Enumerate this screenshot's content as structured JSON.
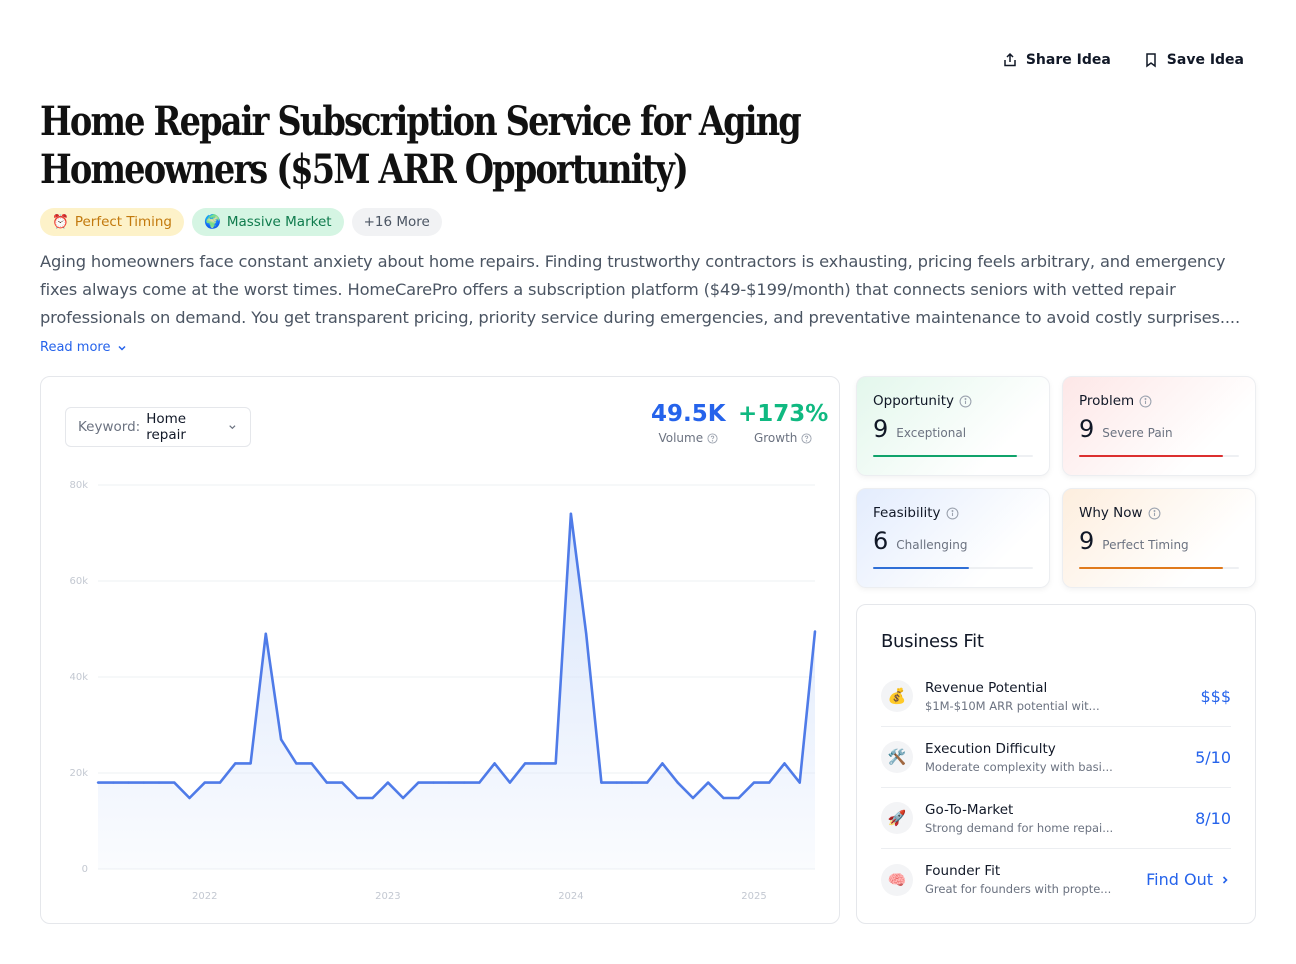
{
  "header": {
    "share_label": "Share Idea",
    "save_label": "Save Idea",
    "title": "Home Repair Subscription Service for Aging Homeowners ($5M ARR Opportunity)"
  },
  "tags": [
    {
      "emoji": "⏰",
      "label": "Perfect Timing"
    },
    {
      "emoji": "🌍",
      "label": "Massive Market"
    },
    {
      "label": "+16 More"
    }
  ],
  "description": "Aging homeowners face constant anxiety about home repairs. Finding trustworthy contractors is exhausting, pricing feels arbitrary, and emergency fixes always come at the worst times. HomeCarePro offers a subscription platform ($49-$199/month) that connects seniors with vetted repair professionals on demand. You get transparent pricing, priority service during emergencies, and preventative maintenance to avoid costly surprises....",
  "read_more": "Read more",
  "keyword": {
    "label": "Keyword:",
    "value": "Home repair"
  },
  "metrics": {
    "volume": {
      "value": "49.5K",
      "label": "Volume"
    },
    "growth": {
      "value": "+173%",
      "label": "Growth"
    }
  },
  "chart_data": {
    "type": "area",
    "y_ticks": [
      "0",
      "20k",
      "40k",
      "60k",
      "80k"
    ],
    "ylim": [
      0,
      80000
    ],
    "x_ticks": [
      {
        "label": "2022",
        "month": 7
      },
      {
        "label": "2023",
        "month": 19
      },
      {
        "label": "2024",
        "month": 31
      },
      {
        "label": "2025",
        "month": 43
      }
    ],
    "x_range": [
      0,
      47
    ],
    "series": [
      {
        "values": [
          18000,
          18000,
          18000,
          18000,
          18000,
          18000,
          14800,
          18000,
          18000,
          22000,
          22000,
          49000,
          27000,
          22000,
          22000,
          18000,
          18000,
          14800,
          14800,
          18000,
          14800,
          18000,
          18000,
          18000,
          18000,
          18000,
          22000,
          18000,
          22000,
          22000,
          22000,
          74000,
          49000,
          18000,
          18000,
          18000,
          18000,
          22000,
          18000,
          14800,
          18000,
          14800,
          14800,
          18000,
          18000,
          22000,
          18000,
          49500
        ]
      }
    ],
    "colors": {
      "line": "#4f7be8",
      "fill_top": "#d7e4fb",
      "grid": "#eef0f3",
      "tick": "#c3c8d1"
    }
  },
  "scores": {
    "opportunity": {
      "title": "Opportunity",
      "value": "9",
      "label": "Exceptional",
      "level": 0.9,
      "color": "#10a36b"
    },
    "problem": {
      "title": "Problem",
      "value": "9",
      "label": "Severe Pain",
      "level": 0.9,
      "color": "#dc2f2f"
    },
    "feasibility": {
      "title": "Feasibility",
      "value": "6",
      "label": "Challenging",
      "level": 0.6,
      "color": "#2f6fd6"
    },
    "why_now": {
      "title": "Why Now",
      "value": "9",
      "label": "Perfect Timing",
      "level": 0.9,
      "color": "#e07a1c"
    }
  },
  "business_fit": {
    "title": "Business Fit",
    "items": [
      {
        "icon": "💰",
        "name": "Revenue Potential",
        "sub": "$1M-$10M ARR potential wit...",
        "value": "$$$"
      },
      {
        "icon": "🛠️",
        "name": "Execution Difficulty",
        "sub": "Moderate complexity with basi...",
        "value": "5/10"
      },
      {
        "icon": "🚀",
        "name": "Go-To-Market",
        "sub": "Strong demand for home repai...",
        "value": "8/10"
      },
      {
        "icon": "🧠",
        "name": "Founder Fit",
        "sub": "Great for founders with propte...",
        "value": "Find Out"
      }
    ]
  }
}
